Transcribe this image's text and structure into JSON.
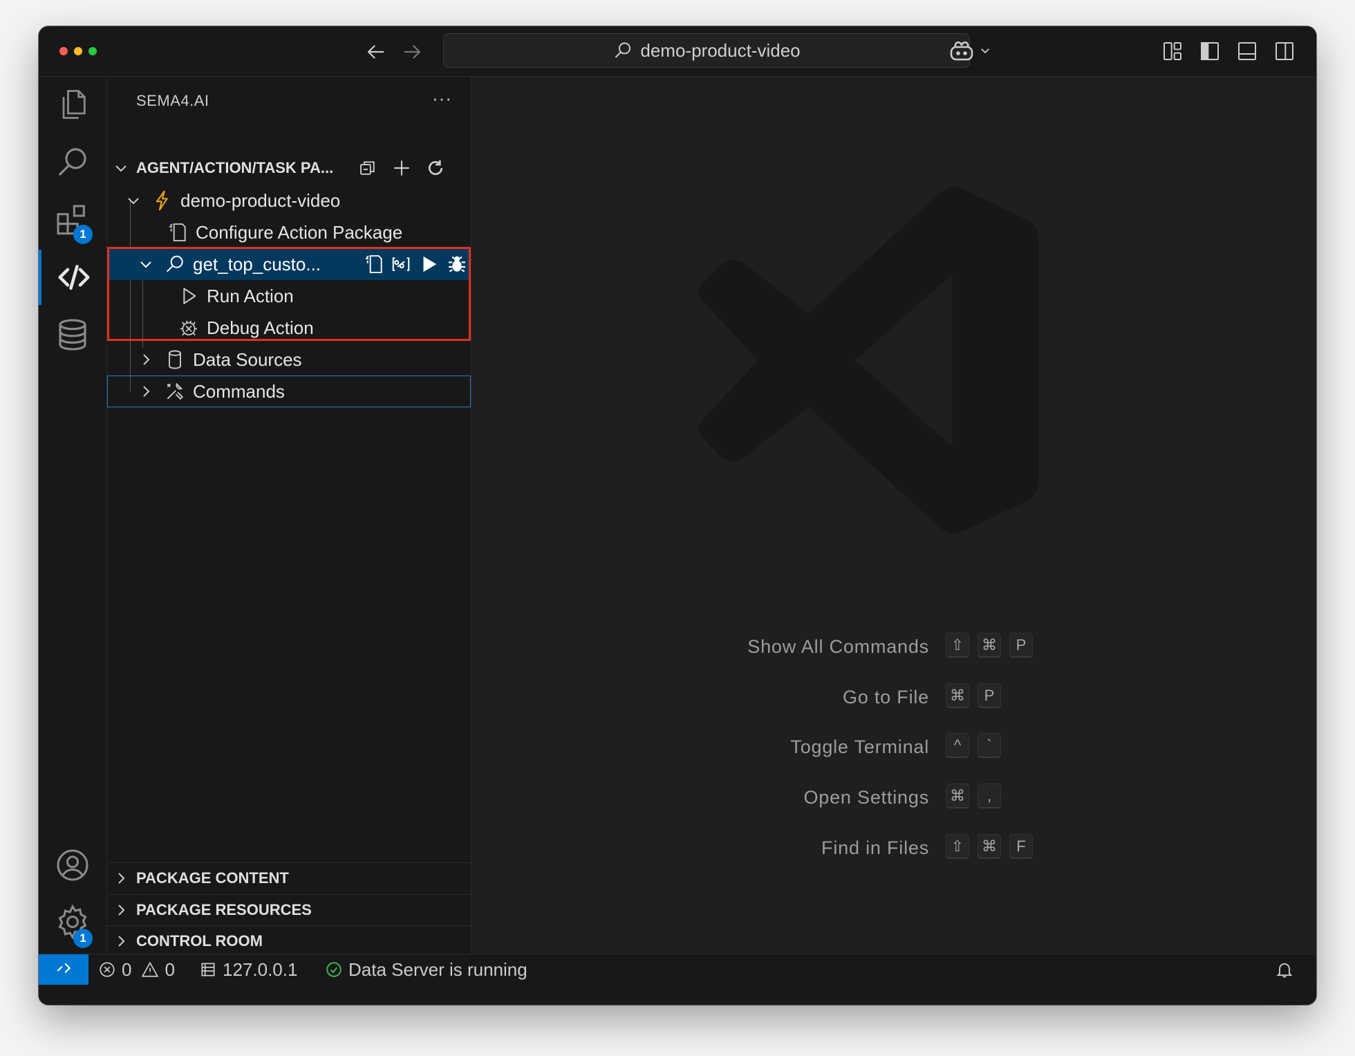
{
  "window": {
    "search_text": "demo-product-video"
  },
  "activity_bar": {
    "extensions_badge": "1",
    "settings_badge": "1"
  },
  "sidebar": {
    "title": "SEMA4.AI",
    "more_label": "···",
    "section_title": "AGENT/ACTION/TASK PA...",
    "tree": {
      "package": "demo-product-video",
      "configure": "Configure Action Package",
      "action": "get_top_custo...",
      "run": "Run Action",
      "debug": "Debug Action",
      "data_sources": "Data Sources",
      "commands": "Commands"
    },
    "bottom_sections": [
      "PACKAGE CONTENT",
      "PACKAGE RESOURCES",
      "CONTROL ROOM"
    ]
  },
  "editor": {
    "shortcuts": [
      {
        "label": "Show All Commands",
        "keys": [
          "⇧",
          "⌘",
          "P"
        ]
      },
      {
        "label": "Go to File",
        "keys": [
          "⌘",
          "P"
        ]
      },
      {
        "label": "Toggle Terminal",
        "keys": [
          "^",
          "`"
        ]
      },
      {
        "label": "Open Settings",
        "keys": [
          "⌘",
          ","
        ]
      },
      {
        "label": "Find in Files",
        "keys": [
          "⇧",
          "⌘",
          "F"
        ]
      }
    ]
  },
  "statusbar": {
    "errors": "0",
    "warnings": "0",
    "host": "127.0.0.1",
    "server_status": "Data Server is running"
  },
  "colors": {
    "accent": "#0078d4",
    "selection": "#04395e",
    "highlight_border": "#e0311f",
    "package_icon": "#e8a317"
  }
}
